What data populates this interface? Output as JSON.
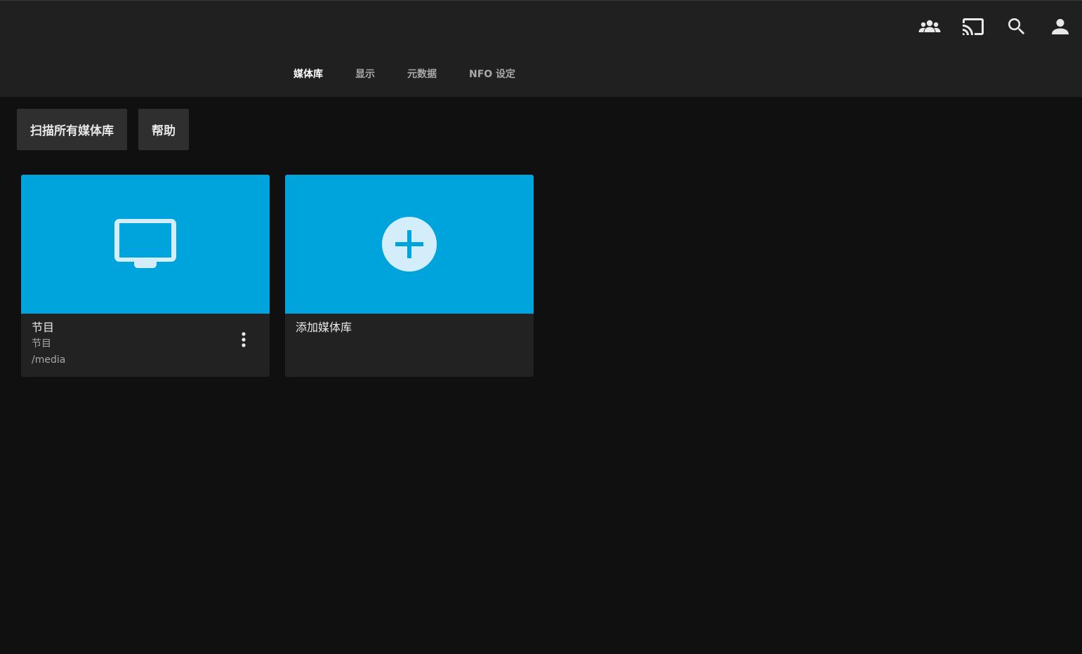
{
  "header": {
    "icons": [
      "users-icon",
      "cast-icon",
      "search-icon",
      "user-icon"
    ]
  },
  "tabs": [
    {
      "label": "媒体库",
      "active": true
    },
    {
      "label": "显示",
      "active": false
    },
    {
      "label": "元数据",
      "active": false
    },
    {
      "label": "NFO 设定",
      "active": false
    }
  ],
  "toolbar": {
    "scan_label": "扫描所有媒体库",
    "help_label": "帮助"
  },
  "libraries": [
    {
      "title": "节目",
      "type": "节目",
      "path": "/media",
      "icon": "tv-icon"
    }
  ],
  "add_library": {
    "label": "添加媒体库",
    "icon": "add-icon"
  },
  "colors": {
    "accent": "#00a4dc",
    "header_bg": "#202020",
    "page_bg": "#101010"
  }
}
